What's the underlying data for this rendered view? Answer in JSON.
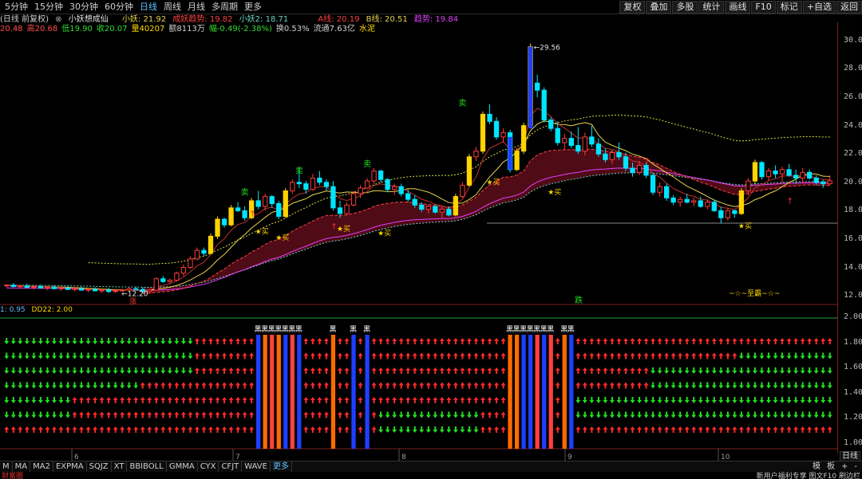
{
  "toolbar": {
    "periods": [
      "5分钟",
      "15分钟",
      "30分钟",
      "60分钟",
      "日线",
      "周线",
      "月线",
      "多周期",
      "更多"
    ],
    "active_period": "日线",
    "right_buttons": [
      "复权",
      "叠加",
      "多股",
      "统计",
      "画线",
      "F10",
      "标记",
      "+自选",
      "返回"
    ]
  },
  "info": {
    "chart_title": "(日线 前复权)",
    "icon": "⊗",
    "indicator_name": "小妖想成仙",
    "xiaoyao_label": "小妖: 21.92",
    "trend_label": "成妖趋势: 19.82",
    "xiaoyao2_label": "小妖2: 18.71",
    "aline_label": "A线: 20.19",
    "bline_label": "B线: 20.51",
    "trend2_label": "趋势: 19.84",
    "row2": [
      {
        "text": "20.48",
        "color": "#ff4d4d"
      },
      {
        "text": "高20.68",
        "color": "#ff4d4d"
      },
      {
        "text": "低19.90",
        "color": "#33dd33"
      },
      {
        "text": "收20.07",
        "color": "#33dd33"
      },
      {
        "text": "量40207",
        "color": "#ffd700"
      },
      {
        "text": "额8113万",
        "color": "#d0d0d0"
      },
      {
        "text": "幅-0.49(-2.38%)",
        "color": "#33dd33"
      },
      {
        "text": "换0.53%",
        "color": "#d0d0d0"
      },
      {
        "text": "流通7.63亿",
        "color": "#d0d0d0"
      },
      {
        "text": "水泥",
        "color": "#ffd700"
      }
    ]
  },
  "price_axis": [
    "30.00",
    "28.00",
    "26.00",
    "24.00",
    "22.00",
    "20.00",
    "18.00",
    "16.00",
    "14.00",
    "12.00"
  ],
  "lower_axis": [
    "2.00",
    "1.80",
    "1.60",
    "1.40",
    "1.20",
    "1.00"
  ],
  "month_labels": [
    "6",
    "7",
    "8",
    "9",
    "10"
  ],
  "annotations": {
    "high": "29.56",
    "low": "12.20",
    "sell": "卖",
    "buy": "买",
    "rise": "涨",
    "fall": "跌",
    "dragon": "~☆~至霸~☆~",
    "hei": "黑"
  },
  "indicator_bottom": {
    "label1": "1: 0.95",
    "label2": "DD22: 2.00"
  },
  "bottom_tabs": [
    "M",
    "MA",
    "MA2",
    "EXPMA",
    "SQJZ",
    "XT",
    "BBIBOLL",
    "GMMA",
    "CYX",
    "CFJT",
    "WAVE",
    "更多"
  ],
  "bottom_right": [
    "模",
    "板",
    "+",
    "-"
  ],
  "day_button": "日线",
  "status": {
    "left": "财富圈",
    "right": "新用户福利专享 图文F10 刷边栏"
  },
  "chart_data": {
    "type": "candlestick",
    "ylim": [
      11.5,
      30.5
    ],
    "candles": [
      [
        12.7,
        12.8,
        12.6,
        12.75
      ],
      [
        12.75,
        12.9,
        12.6,
        12.65
      ],
      [
        12.65,
        12.8,
        12.5,
        12.7
      ],
      [
        12.7,
        12.85,
        12.55,
        12.6
      ],
      [
        12.6,
        12.75,
        12.45,
        12.65
      ],
      [
        12.65,
        12.8,
        12.5,
        12.55
      ],
      [
        12.55,
        12.7,
        12.4,
        12.6
      ],
      [
        12.6,
        12.75,
        12.45,
        12.5
      ],
      [
        12.5,
        12.65,
        12.35,
        12.55
      ],
      [
        12.55,
        12.7,
        12.4,
        12.45
      ],
      [
        12.45,
        12.6,
        12.3,
        12.5
      ],
      [
        12.5,
        12.65,
        12.35,
        12.4
      ],
      [
        12.4,
        12.55,
        12.25,
        12.45
      ],
      [
        12.45,
        12.6,
        12.3,
        12.35
      ],
      [
        12.35,
        12.5,
        12.2,
        12.4
      ],
      [
        12.4,
        12.55,
        12.2,
        12.3
      ],
      [
        12.3,
        12.45,
        12.2,
        12.35
      ],
      [
        12.35,
        12.5,
        12.3,
        12.4
      ],
      [
        12.4,
        12.6,
        12.3,
        12.5
      ],
      [
        12.5,
        12.65,
        12.4,
        12.45
      ],
      [
        12.45,
        12.6,
        12.2,
        12.3
      ],
      [
        12.3,
        12.45,
        12.25,
        12.4
      ],
      [
        12.4,
        13.3,
        12.35,
        13.2
      ],
      [
        13.2,
        13.4,
        12.9,
        13.0
      ],
      [
        13.0,
        13.2,
        12.85,
        13.1
      ],
      [
        13.1,
        13.7,
        13.0,
        13.6
      ],
      [
        13.6,
        14.2,
        13.4,
        14.0
      ],
      [
        14.0,
        14.8,
        13.9,
        14.6
      ],
      [
        14.6,
        15.4,
        14.5,
        15.2
      ],
      [
        15.2,
        15.4,
        14.8,
        15.0
      ],
      [
        15.0,
        16.4,
        14.9,
        16.2
      ],
      [
        16.2,
        17.6,
        16.0,
        17.4
      ],
      [
        17.4,
        17.5,
        16.8,
        17.0
      ],
      [
        17.0,
        18.4,
        16.9,
        18.2
      ],
      [
        18.2,
        18.6,
        17.9,
        18.0
      ],
      [
        18.0,
        18.3,
        17.3,
        17.5
      ],
      [
        17.5,
        18.9,
        17.4,
        18.7
      ],
      [
        18.7,
        19.4,
        18.1,
        18.3
      ],
      [
        18.3,
        19.2,
        18.0,
        19.0
      ],
      [
        19.0,
        19.1,
        18.2,
        18.5
      ],
      [
        18.5,
        18.7,
        17.4,
        17.6
      ],
      [
        17.6,
        19.6,
        17.5,
        19.4
      ],
      [
        19.4,
        20.2,
        19.2,
        20.0
      ],
      [
        20.0,
        21.0,
        19.6,
        19.9
      ],
      [
        19.9,
        20.1,
        19.2,
        19.5
      ],
      [
        19.5,
        20.6,
        19.4,
        20.3
      ],
      [
        20.3,
        20.8,
        19.8,
        20.0
      ],
      [
        20.0,
        20.2,
        19.4,
        19.7
      ],
      [
        19.7,
        20.1,
        18.0,
        18.2
      ],
      [
        18.2,
        18.7,
        17.5,
        17.8
      ],
      [
        17.8,
        18.6,
        17.7,
        18.4
      ],
      [
        18.4,
        19.4,
        18.3,
        19.2
      ],
      [
        19.2,
        19.8,
        18.9,
        19.6
      ],
      [
        19.6,
        20.3,
        19.5,
        20.1
      ],
      [
        20.1,
        21.0,
        19.9,
        20.8
      ],
      [
        20.8,
        20.9,
        20.0,
        20.2
      ],
      [
        20.2,
        20.3,
        19.3,
        19.5
      ],
      [
        19.5,
        19.9,
        19.1,
        19.7
      ],
      [
        19.7,
        19.9,
        19.0,
        19.2
      ],
      [
        19.2,
        19.5,
        18.6,
        18.8
      ],
      [
        18.8,
        19.1,
        18.2,
        18.4
      ],
      [
        18.4,
        18.6,
        17.9,
        18.1
      ],
      [
        18.1,
        18.4,
        17.8,
        18.3
      ],
      [
        18.3,
        18.4,
        17.8,
        17.9
      ],
      [
        17.9,
        18.3,
        17.5,
        18.1
      ],
      [
        18.1,
        18.3,
        17.6,
        17.7
      ],
      [
        17.7,
        19.2,
        17.6,
        19.0
      ],
      [
        19.0,
        20.0,
        18.9,
        19.8
      ],
      [
        19.8,
        22.0,
        19.7,
        21.8
      ],
      [
        21.8,
        22.5,
        21.5,
        22.2
      ],
      [
        22.2,
        25.0,
        22.0,
        24.8
      ],
      [
        24.8,
        25.5,
        24.1,
        24.3
      ],
      [
        24.3,
        24.6,
        23.0,
        23.2
      ],
      [
        23.2,
        23.8,
        22.8,
        23.5
      ],
      [
        23.5,
        23.7,
        20.7,
        20.9
      ],
      [
        20.9,
        22.4,
        20.8,
        22.2
      ],
      [
        22.2,
        24.2,
        22.0,
        24.0
      ],
      [
        24.0,
        29.8,
        23.8,
        29.56
      ],
      [
        27.0,
        27.6,
        26.0,
        26.5
      ],
      [
        26.5,
        26.7,
        24.2,
        24.4
      ],
      [
        24.4,
        24.6,
        23.6,
        23.8
      ],
      [
        23.8,
        24.3,
        22.6,
        22.8
      ],
      [
        22.8,
        23.4,
        22.3,
        23.1
      ],
      [
        23.1,
        23.6,
        22.4,
        22.6
      ],
      [
        22.6,
        23.9,
        22.0,
        22.2
      ],
      [
        22.2,
        23.5,
        21.9,
        23.2
      ],
      [
        23.2,
        24.0,
        22.5,
        22.7
      ],
      [
        22.7,
        23.1,
        21.8,
        22.0
      ],
      [
        22.0,
        22.4,
        21.4,
        21.6
      ],
      [
        21.6,
        22.3,
        21.3,
        22.1
      ],
      [
        22.1,
        22.8,
        21.6,
        21.8
      ],
      [
        21.8,
        22.1,
        20.8,
        21.0
      ],
      [
        21.0,
        21.4,
        20.4,
        20.7
      ],
      [
        20.7,
        21.5,
        20.5,
        21.2
      ],
      [
        21.2,
        21.4,
        20.3,
        20.5
      ],
      [
        20.5,
        20.7,
        19.1,
        19.3
      ],
      [
        19.3,
        20.0,
        19.0,
        19.7
      ],
      [
        19.7,
        19.9,
        18.7,
        18.9
      ],
      [
        18.9,
        19.1,
        18.4,
        18.6
      ],
      [
        18.6,
        19.0,
        18.3,
        18.8
      ],
      [
        18.8,
        19.2,
        18.5,
        18.6
      ],
      [
        18.6,
        18.9,
        18.3,
        18.7
      ],
      [
        18.7,
        19.0,
        18.2,
        18.3
      ],
      [
        18.3,
        18.8,
        18.1,
        18.6
      ],
      [
        18.6,
        18.8,
        17.9,
        18.0
      ],
      [
        18.0,
        18.3,
        17.1,
        17.5
      ],
      [
        17.5,
        18.2,
        17.3,
        18.0
      ],
      [
        18.0,
        18.1,
        17.5,
        17.8
      ],
      [
        17.8,
        19.6,
        17.7,
        19.4
      ],
      [
        19.4,
        20.3,
        19.1,
        20.1
      ],
      [
        20.1,
        21.6,
        19.9,
        21.4
      ],
      [
        21.4,
        21.5,
        20.2,
        20.4
      ],
      [
        20.4,
        21.0,
        20.1,
        20.8
      ],
      [
        20.8,
        21.2,
        20.3,
        20.6
      ],
      [
        20.6,
        21.1,
        20.0,
        20.9
      ],
      [
        20.9,
        21.3,
        20.4,
        20.5
      ],
      [
        20.5,
        20.9,
        19.9,
        20.3
      ],
      [
        20.3,
        21.0,
        20.0,
        20.7
      ],
      [
        20.7,
        20.9,
        20.2,
        20.3
      ],
      [
        20.3,
        20.5,
        19.8,
        20.0
      ],
      [
        20.0,
        20.2,
        19.6,
        19.9
      ],
      [
        19.9,
        20.5,
        19.8,
        20.1
      ]
    ],
    "series": [
      {
        "name": "小妖"
      },
      {
        "name": "成妖趋势"
      },
      {
        "name": "小妖2"
      },
      {
        "name": "A线"
      },
      {
        "name": "B线"
      },
      {
        "name": "趋势"
      }
    ],
    "colors": {
      "up": "#ff3b3b",
      "down": "#00e5ff",
      "hl": "#ffd400",
      "ma_yellow": "#e8d44d",
      "ma_red": "#ff4040",
      "ma_magenta": "#e040fb",
      "ma_cyan": "#6ad0c0",
      "dotted": "#dddd44"
    }
  }
}
